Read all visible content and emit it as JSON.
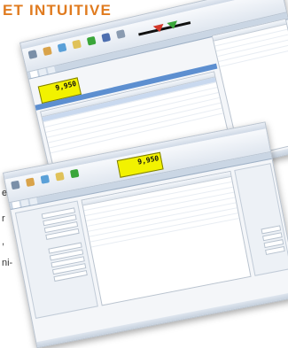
{
  "heading": "ET INTUITIVE",
  "text_fragments": [
    "e",
    "r",
    ",",
    "ni-"
  ],
  "window_top": {
    "lcd_value": "9,950",
    "tabs": [
      "",
      "",
      ""
    ],
    "ribbon_icons": [
      "gear-icon",
      "document-icon",
      "chart-icon",
      "folder-icon",
      "user-icon",
      "printer-icon",
      "help-icon"
    ]
  },
  "window_bottom": {
    "lcd_value": "9,950",
    "tabs": [
      "",
      "",
      ""
    ],
    "ribbon_icons": [
      "gear-icon",
      "document-icon",
      "chart-icon",
      "folder-icon",
      "user-icon"
    ]
  },
  "colors": {
    "heading": "#e07b1f",
    "lcd": "#f2f200",
    "selection": "#5d8fd0",
    "accent_green": "#3aa63a",
    "accent_red": "#d33a2c"
  }
}
